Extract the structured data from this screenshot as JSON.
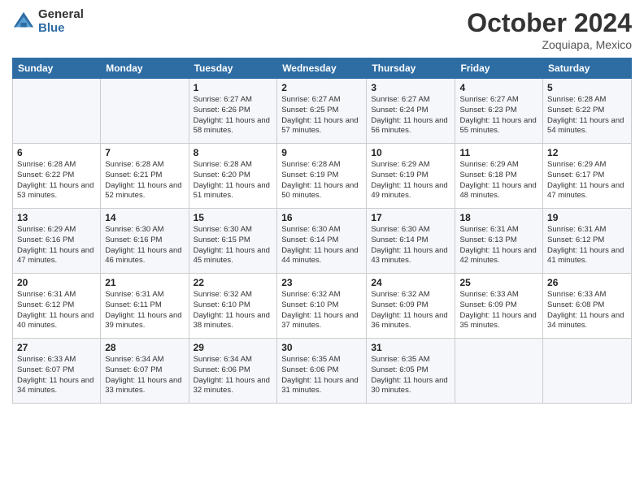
{
  "logo": {
    "general": "General",
    "blue": "Blue"
  },
  "header": {
    "month": "October 2024",
    "location": "Zoquiapa, Mexico"
  },
  "weekdays": [
    "Sunday",
    "Monday",
    "Tuesday",
    "Wednesday",
    "Thursday",
    "Friday",
    "Saturday"
  ],
  "weeks": [
    [
      {
        "day": "",
        "info": ""
      },
      {
        "day": "",
        "info": ""
      },
      {
        "day": "1",
        "info": "Sunrise: 6:27 AM\nSunset: 6:26 PM\nDaylight: 11 hours and 58 minutes."
      },
      {
        "day": "2",
        "info": "Sunrise: 6:27 AM\nSunset: 6:25 PM\nDaylight: 11 hours and 57 minutes."
      },
      {
        "day": "3",
        "info": "Sunrise: 6:27 AM\nSunset: 6:24 PM\nDaylight: 11 hours and 56 minutes."
      },
      {
        "day": "4",
        "info": "Sunrise: 6:27 AM\nSunset: 6:23 PM\nDaylight: 11 hours and 55 minutes."
      },
      {
        "day": "5",
        "info": "Sunrise: 6:28 AM\nSunset: 6:22 PM\nDaylight: 11 hours and 54 minutes."
      }
    ],
    [
      {
        "day": "6",
        "info": "Sunrise: 6:28 AM\nSunset: 6:22 PM\nDaylight: 11 hours and 53 minutes."
      },
      {
        "day": "7",
        "info": "Sunrise: 6:28 AM\nSunset: 6:21 PM\nDaylight: 11 hours and 52 minutes."
      },
      {
        "day": "8",
        "info": "Sunrise: 6:28 AM\nSunset: 6:20 PM\nDaylight: 11 hours and 51 minutes."
      },
      {
        "day": "9",
        "info": "Sunrise: 6:28 AM\nSunset: 6:19 PM\nDaylight: 11 hours and 50 minutes."
      },
      {
        "day": "10",
        "info": "Sunrise: 6:29 AM\nSunset: 6:19 PM\nDaylight: 11 hours and 49 minutes."
      },
      {
        "day": "11",
        "info": "Sunrise: 6:29 AM\nSunset: 6:18 PM\nDaylight: 11 hours and 48 minutes."
      },
      {
        "day": "12",
        "info": "Sunrise: 6:29 AM\nSunset: 6:17 PM\nDaylight: 11 hours and 47 minutes."
      }
    ],
    [
      {
        "day": "13",
        "info": "Sunrise: 6:29 AM\nSunset: 6:16 PM\nDaylight: 11 hours and 47 minutes."
      },
      {
        "day": "14",
        "info": "Sunrise: 6:30 AM\nSunset: 6:16 PM\nDaylight: 11 hours and 46 minutes."
      },
      {
        "day": "15",
        "info": "Sunrise: 6:30 AM\nSunset: 6:15 PM\nDaylight: 11 hours and 45 minutes."
      },
      {
        "day": "16",
        "info": "Sunrise: 6:30 AM\nSunset: 6:14 PM\nDaylight: 11 hours and 44 minutes."
      },
      {
        "day": "17",
        "info": "Sunrise: 6:30 AM\nSunset: 6:14 PM\nDaylight: 11 hours and 43 minutes."
      },
      {
        "day": "18",
        "info": "Sunrise: 6:31 AM\nSunset: 6:13 PM\nDaylight: 11 hours and 42 minutes."
      },
      {
        "day": "19",
        "info": "Sunrise: 6:31 AM\nSunset: 6:12 PM\nDaylight: 11 hours and 41 minutes."
      }
    ],
    [
      {
        "day": "20",
        "info": "Sunrise: 6:31 AM\nSunset: 6:12 PM\nDaylight: 11 hours and 40 minutes."
      },
      {
        "day": "21",
        "info": "Sunrise: 6:31 AM\nSunset: 6:11 PM\nDaylight: 11 hours and 39 minutes."
      },
      {
        "day": "22",
        "info": "Sunrise: 6:32 AM\nSunset: 6:10 PM\nDaylight: 11 hours and 38 minutes."
      },
      {
        "day": "23",
        "info": "Sunrise: 6:32 AM\nSunset: 6:10 PM\nDaylight: 11 hours and 37 minutes."
      },
      {
        "day": "24",
        "info": "Sunrise: 6:32 AM\nSunset: 6:09 PM\nDaylight: 11 hours and 36 minutes."
      },
      {
        "day": "25",
        "info": "Sunrise: 6:33 AM\nSunset: 6:09 PM\nDaylight: 11 hours and 35 minutes."
      },
      {
        "day": "26",
        "info": "Sunrise: 6:33 AM\nSunset: 6:08 PM\nDaylight: 11 hours and 34 minutes."
      }
    ],
    [
      {
        "day": "27",
        "info": "Sunrise: 6:33 AM\nSunset: 6:07 PM\nDaylight: 11 hours and 34 minutes."
      },
      {
        "day": "28",
        "info": "Sunrise: 6:34 AM\nSunset: 6:07 PM\nDaylight: 11 hours and 33 minutes."
      },
      {
        "day": "29",
        "info": "Sunrise: 6:34 AM\nSunset: 6:06 PM\nDaylight: 11 hours and 32 minutes."
      },
      {
        "day": "30",
        "info": "Sunrise: 6:35 AM\nSunset: 6:06 PM\nDaylight: 11 hours and 31 minutes."
      },
      {
        "day": "31",
        "info": "Sunrise: 6:35 AM\nSunset: 6:05 PM\nDaylight: 11 hours and 30 minutes."
      },
      {
        "day": "",
        "info": ""
      },
      {
        "day": "",
        "info": ""
      }
    ]
  ]
}
